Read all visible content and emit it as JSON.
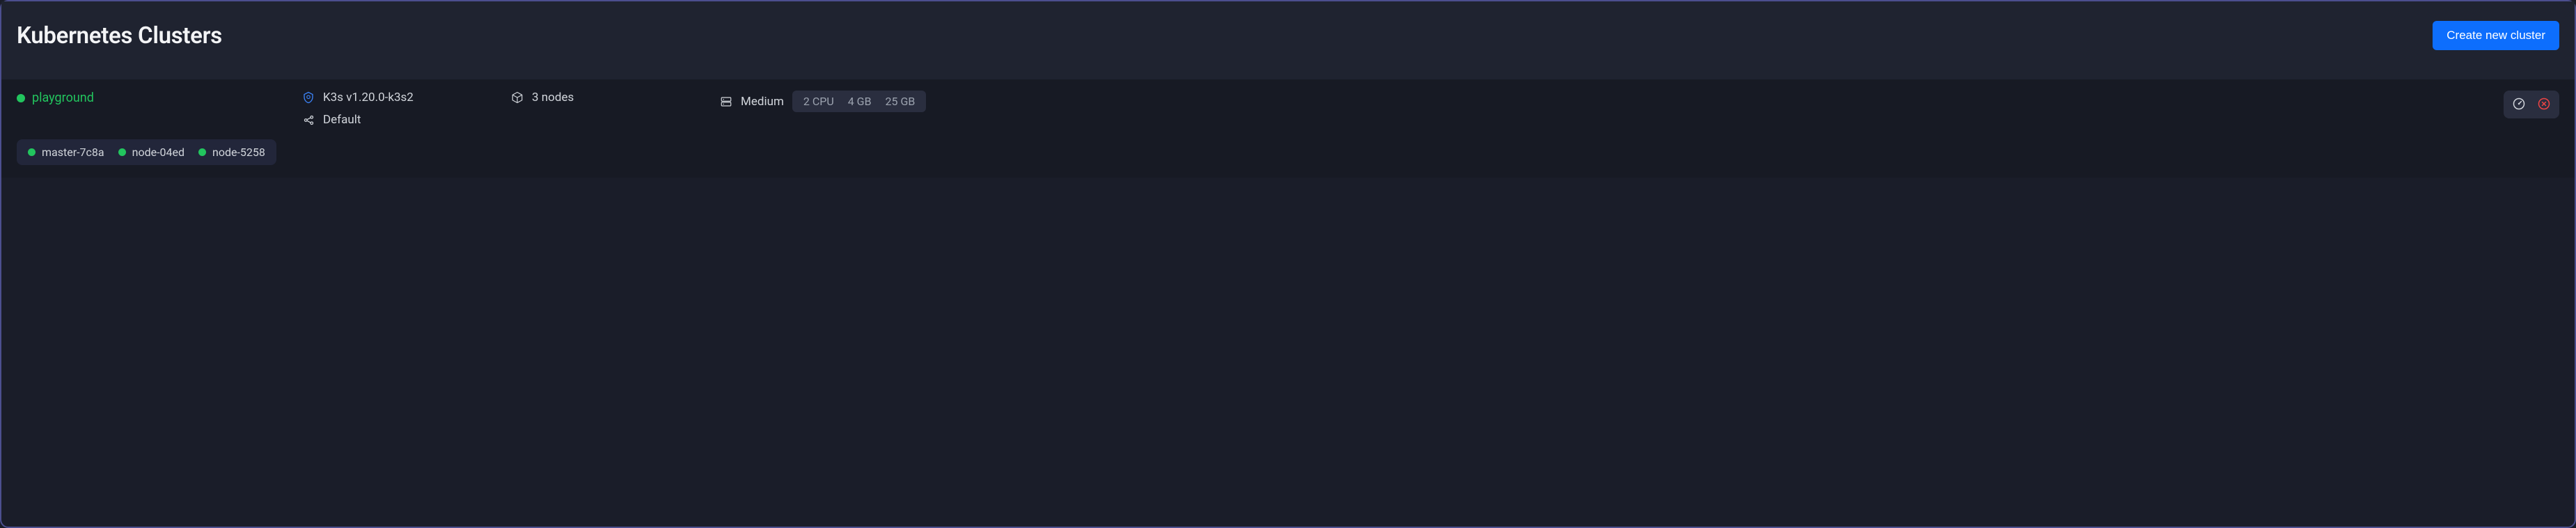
{
  "header": {
    "title": "Kubernetes Clusters",
    "create_button": "Create new cluster"
  },
  "cluster": {
    "name": "playground",
    "distro": "K3s v1.20.0-k3s2",
    "network": "Default",
    "nodes_count": "3 nodes",
    "size_label": "Medium",
    "specs": {
      "cpu": "2 CPU",
      "ram": "4 GB",
      "disk": "25 GB"
    },
    "nodes": [
      {
        "name": "master-7c8a"
      },
      {
        "name": "node-04ed"
      },
      {
        "name": "node-5258"
      }
    ]
  }
}
